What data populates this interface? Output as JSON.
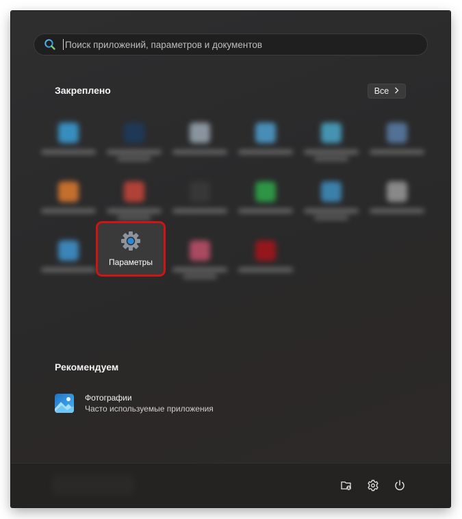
{
  "search": {
    "placeholder": "Поиск приложений, параметров и документов",
    "icon": "search-icon"
  },
  "pinned": {
    "title": "Закреплено",
    "all_label": "Все",
    "all_icon": "chevron-right-icon",
    "blurred_tiles": [
      {
        "icon_color": "#3aa0d8"
      },
      {
        "icon_color": "#1d3b5e"
      },
      {
        "icon_color": "#9aa7b3"
      },
      {
        "icon_color": "#4e9fd0"
      },
      {
        "icon_color": "#49a7c9"
      },
      {
        "icon_color": "#5a7ea8"
      },
      {
        "icon_color": "#e07b2f"
      },
      {
        "icon_color": "#c8463a"
      },
      {
        "icon_color": "#3a3a3a"
      },
      {
        "icon_color": "#2ea84a"
      },
      {
        "icon_color": "#3f8fc0"
      },
      {
        "icon_color": "#9a9a9a"
      },
      {
        "icon_color": "#3f95d1"
      },
      {
        "icon_color": "#c0506a"
      },
      {
        "icon_color": "#a8141c"
      }
    ],
    "highlighted_app": {
      "label": "Параметры",
      "icon": "gear-icon",
      "highlight_color": "#d01313"
    }
  },
  "recommended": {
    "title": "Рекомендуем",
    "items": [
      {
        "title": "Фотографии",
        "subtitle": "Часто используемые приложения",
        "icon": "photos-icon"
      }
    ]
  },
  "bottom_bar": {
    "icons": [
      "file-explorer-icon",
      "settings-gear-icon",
      "power-icon"
    ]
  }
}
